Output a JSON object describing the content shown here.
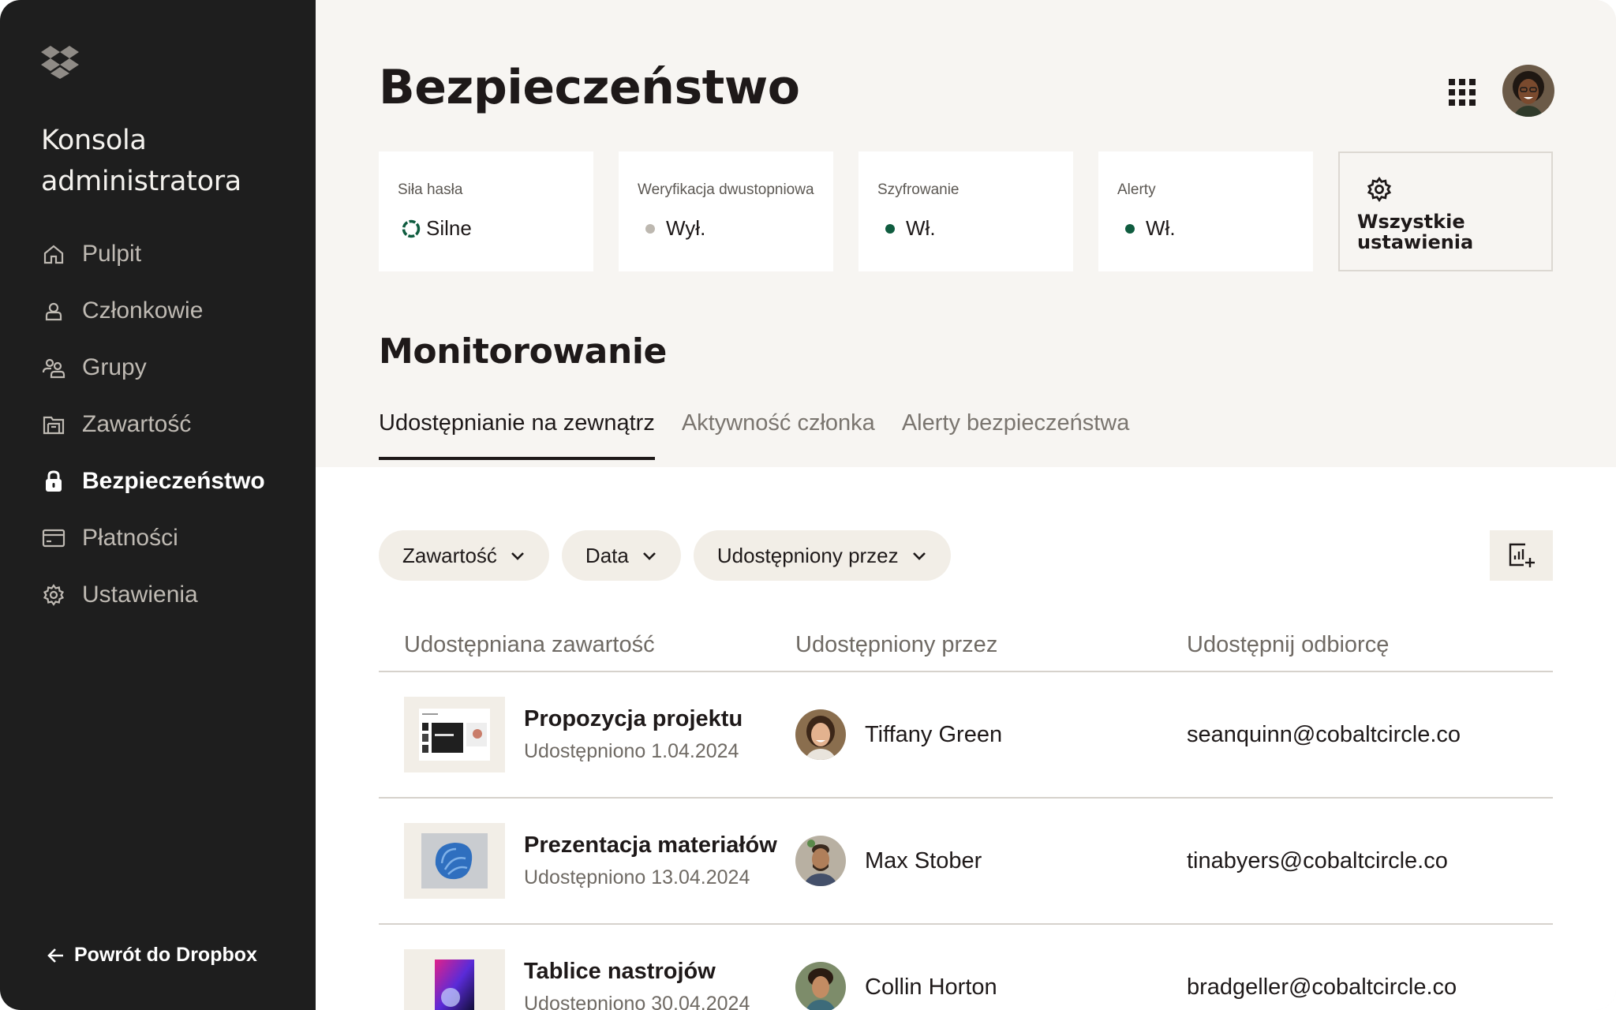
{
  "sidebar": {
    "title": "Konsola administratora",
    "items": [
      {
        "label": "Pulpit",
        "icon": "home-icon",
        "active": false
      },
      {
        "label": "Członkowie",
        "icon": "person-icon",
        "active": false
      },
      {
        "label": "Grupy",
        "icon": "group-icon",
        "active": false
      },
      {
        "label": "Zawartość",
        "icon": "folder-icon",
        "active": false
      },
      {
        "label": "Bezpieczeństwo",
        "icon": "lock-icon",
        "active": true
      },
      {
        "label": "Płatności",
        "icon": "card-icon",
        "active": false
      },
      {
        "label": "Ustawienia",
        "icon": "gear-icon",
        "active": false
      }
    ],
    "back_label": "Powrót do Dropbox"
  },
  "header": {
    "title": "Bezpieczeństwo"
  },
  "cards": [
    {
      "label": "Siła hasła",
      "value": "Silne",
      "status": "strong"
    },
    {
      "label": "Weryfikacja dwustopniowa",
      "value": "Wył.",
      "status": "off",
      "color": "#bdb8b0"
    },
    {
      "label": "Szyfrowanie",
      "value": "Wł.",
      "status": "on",
      "color": "#0f5c3f"
    },
    {
      "label": "Alerty",
      "value": "Wł.",
      "status": "on",
      "color": "#0f5c3f"
    }
  ],
  "settings_card": {
    "label": "Wszystkie ustawienia"
  },
  "monitoring": {
    "title": "Monitorowanie",
    "tabs": [
      {
        "label": "Udostępnianie na zewnątrz",
        "active": true
      },
      {
        "label": "Aktywność członka",
        "active": false
      },
      {
        "label": "Alerty bezpieczeństwa",
        "active": false
      }
    ],
    "filters": [
      {
        "label": "Zawartość"
      },
      {
        "label": "Data"
      },
      {
        "label": "Udostępniony przez"
      }
    ]
  },
  "table": {
    "headers": [
      "Udostępniana zawartość",
      "Udostępniony przez",
      "Udostępnij odbiorcę"
    ],
    "rows": [
      {
        "name": "Propozycja projektu",
        "date": "Udostępniono 1.04.2024",
        "person": "Tiffany Green",
        "recipient": "seanquinn@cobaltcircle.co"
      },
      {
        "name": "Prezentacja materiałów",
        "date": "Udostępniono 13.04.2024",
        "person": "Max Stober",
        "recipient": "tinabyers@cobaltcircle.co"
      },
      {
        "name": "Tablice nastrojów",
        "date": "Udostępniono 30.04.2024",
        "person": "Collin Horton",
        "recipient": "bradgeller@cobaltcircle.co"
      }
    ]
  },
  "colors": {
    "sidebar_bg": "#1e1e1e",
    "page_bg": "#f7f5f2",
    "chip_bg": "#f2eee7",
    "on_status": "#0f5c3f",
    "off_status": "#bdb8b0"
  }
}
